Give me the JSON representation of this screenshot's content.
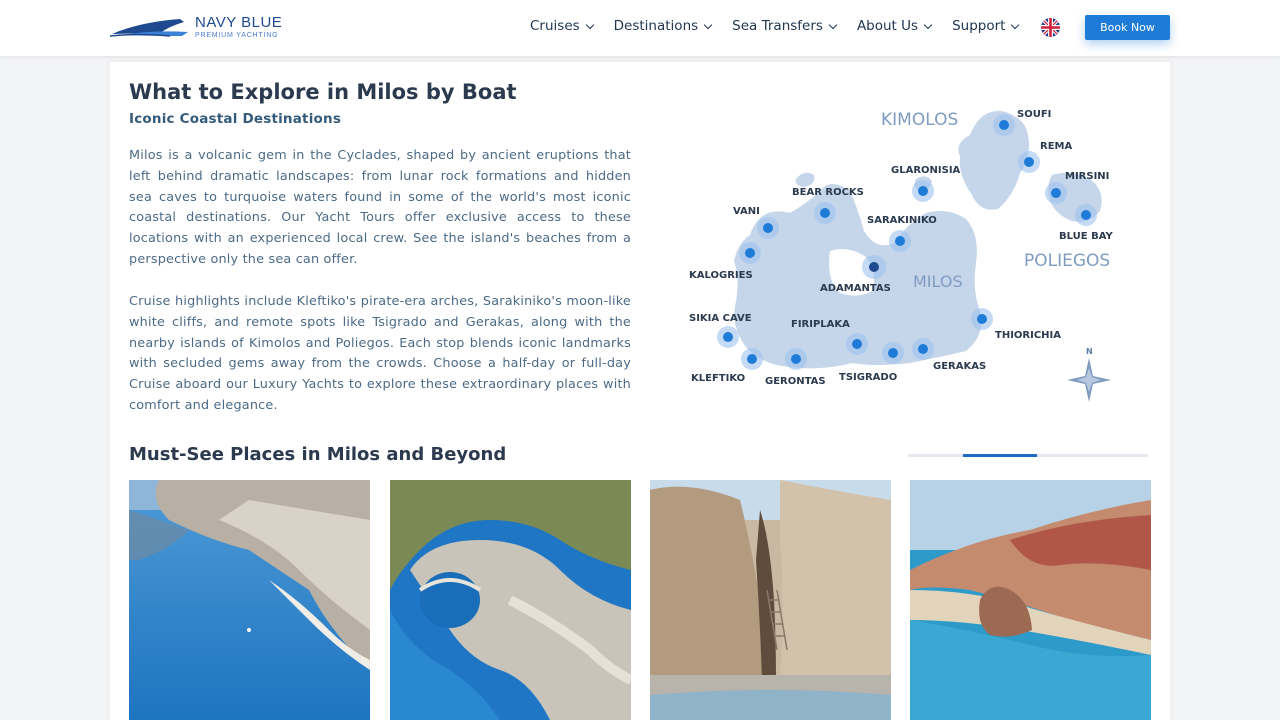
{
  "brand": {
    "name": "NAVY BLUE",
    "tagline": "PREMIUM YACHTING"
  },
  "nav": {
    "items": [
      "Cruises",
      "Destinations",
      "Sea Transfers",
      "About Us",
      "Support"
    ],
    "language_icon": "uk-flag-icon",
    "book_label": "Book Now"
  },
  "colors": {
    "accent": "#1f7bd8",
    "heading": "#2b3a4e",
    "map_land": "#c5d6ea",
    "pin": "#1f7bd8"
  },
  "main": {
    "title": "What to Explore in Milos by Boat",
    "subtitle": "Iconic Coastal Destinations",
    "paragraph1": "Milos is a volcanic gem in the Cyclades, shaped by ancient eruptions that left behind dramatic landscapes: from lunar rock formations and hidden sea caves to turquoise waters found in some of the world's most iconic coastal destinations. Our Yacht Tours offer exclusive access to these locations with an experienced local crew. See the island's beaches from a perspective only the sea can offer.",
    "paragraph2": "Cruise highlights include Kleftiko's pirate-era arches, Sarakiniko's moon-like white cliffs, and remote spots like Tsigrado and Gerakas, along with the nearby islands of Kimolos and Poliegos. Each stop blends iconic landmarks with secluded gems away from the crowds. Choose a half-day or full-day Cruise aboard our Luxury Yachts to explore these extraordinary places with comfort and elegance."
  },
  "map": {
    "islands": [
      "KIMOLOS",
      "MILOS",
      "POLIEGOS"
    ],
    "places": [
      "SOUFI",
      "REMA",
      "MIRSINI",
      "BLUE BAY",
      "GLARONISIA",
      "BEAR ROCKS",
      "SARAKINIKO",
      "VANI",
      "KALOGRIES",
      "ADAMANTAS",
      "SIKIA CAVE",
      "FIRIPLAKA",
      "THIORICHIA",
      "KLEFTIKO",
      "GERONTAS",
      "TSIGRADO",
      "GERAKAS"
    ],
    "compass_label": "N"
  },
  "gallery": {
    "title": "Must-See Places in Milos and Beyond",
    "slider_position": 0.33
  }
}
